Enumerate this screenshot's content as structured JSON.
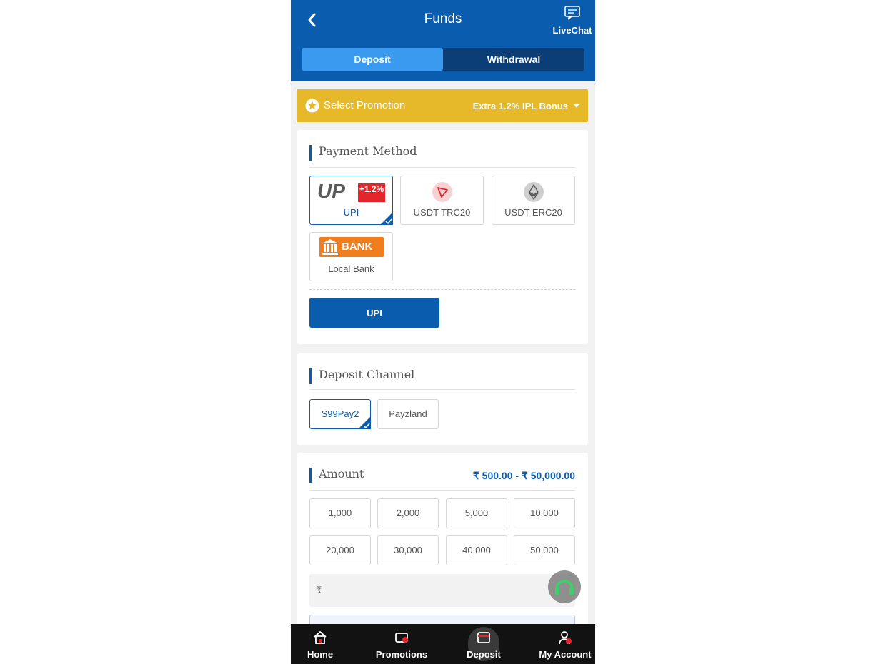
{
  "header": {
    "title": "Funds",
    "livechat_label": "LiveChat",
    "tabs": [
      {
        "label": "Deposit",
        "active": true
      },
      {
        "label": "Withdrawal",
        "active": false
      }
    ]
  },
  "promotion": {
    "label": "Select Promotion",
    "value": "Extra 1.2% IPL Bonus"
  },
  "payment_method": {
    "title": "Payment Method",
    "methods": [
      {
        "name": "UPI",
        "badge": "+1.2%",
        "selected": true
      },
      {
        "name": "USDT TRC20",
        "selected": false
      },
      {
        "name": "USDT ERC20",
        "selected": false
      },
      {
        "name": "Local Bank",
        "logo_text": "BANK",
        "selected": false
      }
    ],
    "selected_button": "UPI"
  },
  "deposit_channel": {
    "title": "Deposit Channel",
    "channels": [
      {
        "name": "S99Pay2",
        "selected": true
      },
      {
        "name": "Payzland",
        "selected": false
      }
    ]
  },
  "amount": {
    "title": "Amount",
    "range": "₹ 500.00 - ₹ 50,000.00",
    "presets": [
      "1,000",
      "2,000",
      "5,000",
      "10,000",
      "20,000",
      "30,000",
      "40,000",
      "50,000"
    ],
    "currency_symbol": "₹",
    "input_value": ""
  },
  "bottom_nav": [
    {
      "label": "Home",
      "icon": "home-icon"
    },
    {
      "label": "Promotions",
      "icon": "ticket-icon"
    },
    {
      "label": "Deposit",
      "icon": "wallet-icon",
      "active": true
    },
    {
      "label": "My Account",
      "icon": "user-icon"
    }
  ],
  "colors": {
    "primary": "#0a5cae",
    "tab_active": "#3a9af0",
    "promo": "#e6b92a",
    "nav_bg": "#121212"
  }
}
